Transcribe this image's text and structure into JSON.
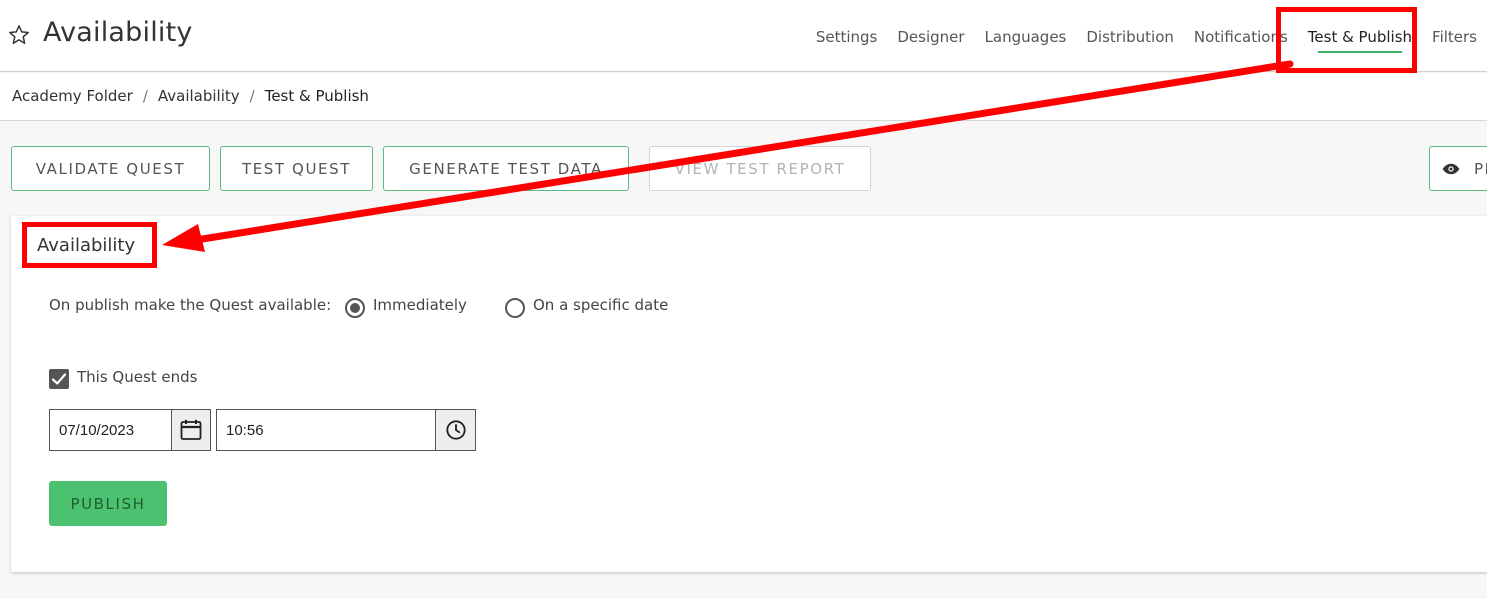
{
  "header": {
    "title": "Availability",
    "star_icon": "star-outline-icon",
    "nav": [
      {
        "label": "Settings"
      },
      {
        "label": "Designer"
      },
      {
        "label": "Languages"
      },
      {
        "label": "Distribution"
      },
      {
        "label": "Notifications"
      },
      {
        "label": "Test & Publish",
        "active": true
      },
      {
        "label": "Filters"
      }
    ]
  },
  "breadcrumb": {
    "items": [
      "Academy Folder",
      "Availability",
      "Test & Publish"
    ],
    "separator": "/"
  },
  "toolbar": {
    "validate_label": "VALIDATE QUEST",
    "test_label": "TEST QUEST",
    "generate_label": "GENERATE TEST DATA",
    "report_label": "VIEW TEST REPORT",
    "preview_label": "PR",
    "preview_icon": "eye-icon"
  },
  "availability": {
    "title": "Availability",
    "prompt": "On publish make the Quest available:",
    "options": [
      {
        "label": "Immediately",
        "selected": true
      },
      {
        "label": "On a specific date",
        "selected": false
      }
    ],
    "ends_label": "This Quest ends",
    "ends_checked": true,
    "end_date": "07/10/2023",
    "end_time": "10:56",
    "calendar_icon": "calendar-icon",
    "clock_icon": "clock-icon",
    "publish_label": "PUBLISH"
  },
  "colors": {
    "accent_green": "#4cc16f",
    "outline_green": "#5cb984",
    "annotation_red": "#ff0000"
  }
}
